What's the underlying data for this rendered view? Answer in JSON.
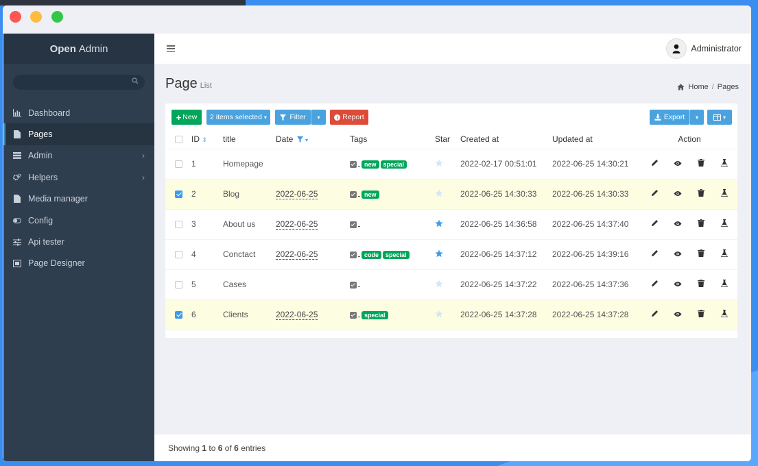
{
  "app": {
    "brand_bold": "Open",
    "brand_rest": "Admin"
  },
  "sidebar": {
    "items": [
      {
        "label": "Dashboard",
        "icon": "bar-chart-icon",
        "active": false,
        "chevron": false
      },
      {
        "label": "Pages",
        "icon": "file-icon",
        "active": true,
        "chevron": false
      },
      {
        "label": "Admin",
        "icon": "tasks-icon",
        "active": false,
        "chevron": true
      },
      {
        "label": "Helpers",
        "icon": "gears-icon",
        "active": false,
        "chevron": true
      },
      {
        "label": "Media manager",
        "icon": "file-icon",
        "active": false,
        "chevron": false
      },
      {
        "label": "Config",
        "icon": "toggle-icon",
        "active": false,
        "chevron": false
      },
      {
        "label": "Api tester",
        "icon": "sliders-icon",
        "active": false,
        "chevron": false
      },
      {
        "label": "Page Designer",
        "icon": "map-icon",
        "active": false,
        "chevron": false
      }
    ]
  },
  "topbar": {
    "user_name": "Administrator"
  },
  "page": {
    "title": "Page",
    "subtitle": "List"
  },
  "breadcrumb": {
    "home": "Home",
    "separator": "/",
    "current": "Pages"
  },
  "toolbar": {
    "new_label": "New",
    "selected_label": "2 items selected",
    "filter_label": "Filter",
    "report_label": "Report",
    "export_label": "Export"
  },
  "table": {
    "headers": {
      "id": "ID",
      "title": "title",
      "date": "Date",
      "tags": "Tags",
      "star": "Star",
      "created": "Created at",
      "updated": "Updated at",
      "action": "Action"
    },
    "rows": [
      {
        "checked": false,
        "id": "1",
        "title": "Homepage",
        "date": "",
        "tags": [
          "new",
          "special"
        ],
        "starred": false,
        "created": "2022-02-17 00:51:01",
        "updated": "2022-06-25 14:30:21"
      },
      {
        "checked": true,
        "id": "2",
        "title": "Blog",
        "date": "2022-06-25",
        "tags": [
          "new"
        ],
        "starred": false,
        "created": "2022-06-25 14:30:33",
        "updated": "2022-06-25 14:30:33"
      },
      {
        "checked": false,
        "id": "3",
        "title": "About us",
        "date": "2022-06-25",
        "tags": [],
        "starred": true,
        "created": "2022-06-25 14:36:58",
        "updated": "2022-06-25 14:37:40"
      },
      {
        "checked": false,
        "id": "4",
        "title": "Conctact",
        "date": "2022-06-25",
        "tags": [
          "code",
          "special"
        ],
        "starred": true,
        "created": "2022-06-25 14:37:12",
        "updated": "2022-06-25 14:39:16"
      },
      {
        "checked": false,
        "id": "5",
        "title": "Cases",
        "date": "",
        "tags": [],
        "starred": false,
        "created": "2022-06-25 14:37:22",
        "updated": "2022-06-25 14:37:36"
      },
      {
        "checked": true,
        "id": "6",
        "title": "Clients",
        "date": "2022-06-25",
        "tags": [
          "special"
        ],
        "starred": false,
        "created": "2022-06-25 14:37:28",
        "updated": "2022-06-25 14:37:28"
      }
    ]
  },
  "footer": {
    "prefix": "Showing",
    "from": "1",
    "to_word": "to",
    "to": "6",
    "of_word": "of",
    "total": "6",
    "suffix": "entries"
  },
  "colors": {
    "accent": "#4aa3df",
    "green": "#00a65a",
    "red": "#dd4b39",
    "sidebar": "#2f3e4e",
    "star_on": "#3c9be8",
    "star_off": "#d6e6f5"
  }
}
